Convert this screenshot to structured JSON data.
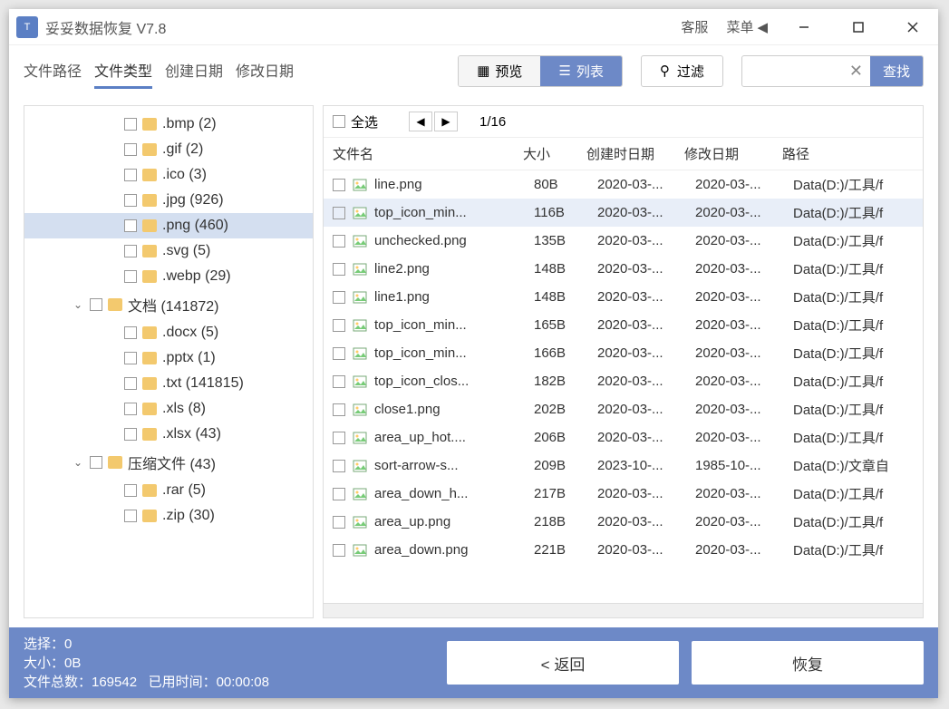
{
  "title": "妥妥数据恢复  V7.8",
  "titlebar": {
    "support": "客服",
    "menu": "菜单"
  },
  "tabs": [
    "文件路径",
    "文件类型",
    "创建日期",
    "修改日期"
  ],
  "active_tab": 1,
  "view": {
    "preview": "预览",
    "list": "列表"
  },
  "filter_label": "过滤",
  "search_label": "查找",
  "select_all": "全选",
  "page_info": "1/16",
  "columns": {
    "name": "文件名",
    "size": "大小",
    "created": "创建时日期",
    "modified": "修改日期",
    "path": "路径"
  },
  "tree": [
    {
      "indent": 2,
      "label": ".bmp  (2)"
    },
    {
      "indent": 2,
      "label": ".gif  (2)"
    },
    {
      "indent": 2,
      "label": ".ico  (3)"
    },
    {
      "indent": 2,
      "label": ".jpg  (926)"
    },
    {
      "indent": 2,
      "label": ".png  (460)",
      "selected": true
    },
    {
      "indent": 2,
      "label": ".svg  (5)"
    },
    {
      "indent": 2,
      "label": ".webp  (29)"
    },
    {
      "indent": 1,
      "expand": "⌄",
      "label": "文档  (141872)"
    },
    {
      "indent": 2,
      "label": ".docx  (5)"
    },
    {
      "indent": 2,
      "label": ".pptx  (1)"
    },
    {
      "indent": 2,
      "label": ".txt  (141815)"
    },
    {
      "indent": 2,
      "label": ".xls  (8)"
    },
    {
      "indent": 2,
      "label": ".xlsx  (43)"
    },
    {
      "indent": 1,
      "expand": "⌄",
      "label": "压缩文件  (43)"
    },
    {
      "indent": 2,
      "label": ".rar  (5)"
    },
    {
      "indent": 2,
      "label": ".zip  (30)"
    }
  ],
  "rows": [
    {
      "name": "line.png",
      "size": "80B",
      "created": "2020-03-...",
      "modified": "2020-03-...",
      "path": "Data(D:)/工具/f"
    },
    {
      "name": "top_icon_min...",
      "size": "116B",
      "created": "2020-03-...",
      "modified": "2020-03-...",
      "path": "Data(D:)/工具/f",
      "highlighted": true
    },
    {
      "name": "unchecked.png",
      "size": "135B",
      "created": "2020-03-...",
      "modified": "2020-03-...",
      "path": "Data(D:)/工具/f"
    },
    {
      "name": "line2.png",
      "size": "148B",
      "created": "2020-03-...",
      "modified": "2020-03-...",
      "path": "Data(D:)/工具/f"
    },
    {
      "name": "line1.png",
      "size": "148B",
      "created": "2020-03-...",
      "modified": "2020-03-...",
      "path": "Data(D:)/工具/f"
    },
    {
      "name": "top_icon_min...",
      "size": "165B",
      "created": "2020-03-...",
      "modified": "2020-03-...",
      "path": "Data(D:)/工具/f"
    },
    {
      "name": "top_icon_min...",
      "size": "166B",
      "created": "2020-03-...",
      "modified": "2020-03-...",
      "path": "Data(D:)/工具/f"
    },
    {
      "name": "top_icon_clos...",
      "size": "182B",
      "created": "2020-03-...",
      "modified": "2020-03-...",
      "path": "Data(D:)/工具/f"
    },
    {
      "name": "close1.png",
      "size": "202B",
      "created": "2020-03-...",
      "modified": "2020-03-...",
      "path": "Data(D:)/工具/f"
    },
    {
      "name": "area_up_hot....",
      "size": "206B",
      "created": "2020-03-...",
      "modified": "2020-03-...",
      "path": "Data(D:)/工具/f"
    },
    {
      "name": "sort-arrow-s...",
      "size": "209B",
      "created": "2023-10-...",
      "modified": "1985-10-...",
      "path": "Data(D:)/文章自"
    },
    {
      "name": "area_down_h...",
      "size": "217B",
      "created": "2020-03-...",
      "modified": "2020-03-...",
      "path": "Data(D:)/工具/f"
    },
    {
      "name": "area_up.png",
      "size": "218B",
      "created": "2020-03-...",
      "modified": "2020-03-...",
      "path": "Data(D:)/工具/f"
    },
    {
      "name": "area_down.png",
      "size": "221B",
      "created": "2020-03-...",
      "modified": "2020-03-...",
      "path": "Data(D:)/工具/f"
    }
  ],
  "status": {
    "select": "选择：0",
    "size": "大小：0B",
    "total": "文件总数：169542",
    "elapsed": "已用时间：00:00:08"
  },
  "back_btn": "< 返回",
  "recover_btn": "恢复"
}
